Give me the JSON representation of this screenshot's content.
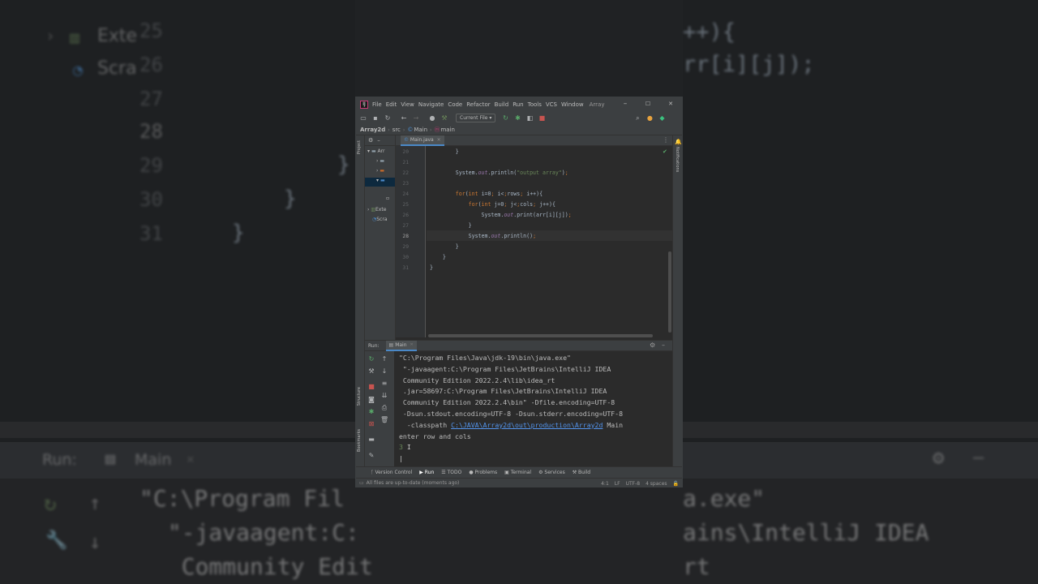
{
  "background": {
    "code_lines": [
      "++){",
      "rr[i][j]);"
    ],
    "line_numbers": [
      "25",
      "26",
      "27",
      "28",
      "29",
      "30",
      "31"
    ],
    "closing_braces": [
      "}",
      "}",
      "}"
    ],
    "sidebar_items": [
      "Exte",
      "Scra"
    ],
    "run_label": "Run:",
    "run_tab": "Main",
    "console_lines": [
      "\"C:\\Program Fil",
      "a.exe\"",
      " \"-javaagent:C:",
      "ains\\IntelliJ IDEA",
      "  Community Edit",
      "rt"
    ]
  },
  "window": {
    "menu": [
      "File",
      "Edit",
      "View",
      "Navigate",
      "Code",
      "Refactor",
      "Build",
      "Run",
      "Tools",
      "VCS",
      "Window"
    ],
    "project_title": "Array",
    "minimize": "–",
    "maximize": "☐",
    "close": "✕"
  },
  "toolbar": {
    "run_config": "Current File"
  },
  "breadcrumb": {
    "project": "Array2d",
    "folder": "src",
    "class": "Main",
    "method": "main"
  },
  "left_strip": {
    "project_tab": "Project",
    "structure_tab": "Structure",
    "bookmarks_tab": "Bookmarks"
  },
  "right_strip": {
    "notifications_tab": "Notifications"
  },
  "project_panel": {
    "items": [
      "Arr",
      "",
      "",
      "",
      "Exte",
      "Scra"
    ]
  },
  "editor": {
    "file_tab": "Main.java",
    "lines": [
      {
        "num": "20",
        "text": "        }"
      },
      {
        "num": "21",
        "text": ""
      },
      {
        "num": "22",
        "text": "        System.out.println(\"output array\");"
      },
      {
        "num": "23",
        "text": ""
      },
      {
        "num": "24",
        "text": "        for(int i=0; i<rows; i++){"
      },
      {
        "num": "25",
        "text": "            for(int j=0; j<cols; j++){"
      },
      {
        "num": "26",
        "text": "                System.out.print(arr[i][j]);"
      },
      {
        "num": "27",
        "text": "            }"
      },
      {
        "num": "28",
        "text": "            System.out.println();"
      },
      {
        "num": "29",
        "text": "        }"
      },
      {
        "num": "30",
        "text": "    }"
      },
      {
        "num": "31",
        "text": "}"
      }
    ],
    "current_line": "28"
  },
  "run_panel": {
    "label": "Run:",
    "tab": "Main",
    "console": [
      "\"C:\\Program Files\\Java\\jdk-19\\bin\\java.exe\"",
      " \"-javaagent:C:\\Program Files\\JetBrains\\IntelliJ IDEA",
      " Community Edition 2022.2.4\\lib\\idea_rt",
      " .jar=58697:C:\\Program Files\\JetBrains\\IntelliJ IDEA",
      " Community Edition 2022.2.4\\bin\" -Dfile.encoding=UTF-8",
      " -Dsun.stdout.encoding=UTF-8 -Dsun.stderr.encoding=UTF-8",
      "  -classpath "
    ],
    "classpath_link": "C:\\JAVA\\Array2d\\out\\production\\Array2d",
    "classpath_suffix": " Main",
    "prompt": "enter row and cols",
    "user_input": "3"
  },
  "bottom_tabs": [
    "Version Control",
    "Run",
    "TODO",
    "Problems",
    "Terminal",
    "Services",
    "Build"
  ],
  "status": {
    "message": "All files are up-to-date (moments ago)",
    "position": "4:1",
    "line_sep": "LF",
    "encoding": "UTF-8",
    "indent": "4 spaces"
  }
}
